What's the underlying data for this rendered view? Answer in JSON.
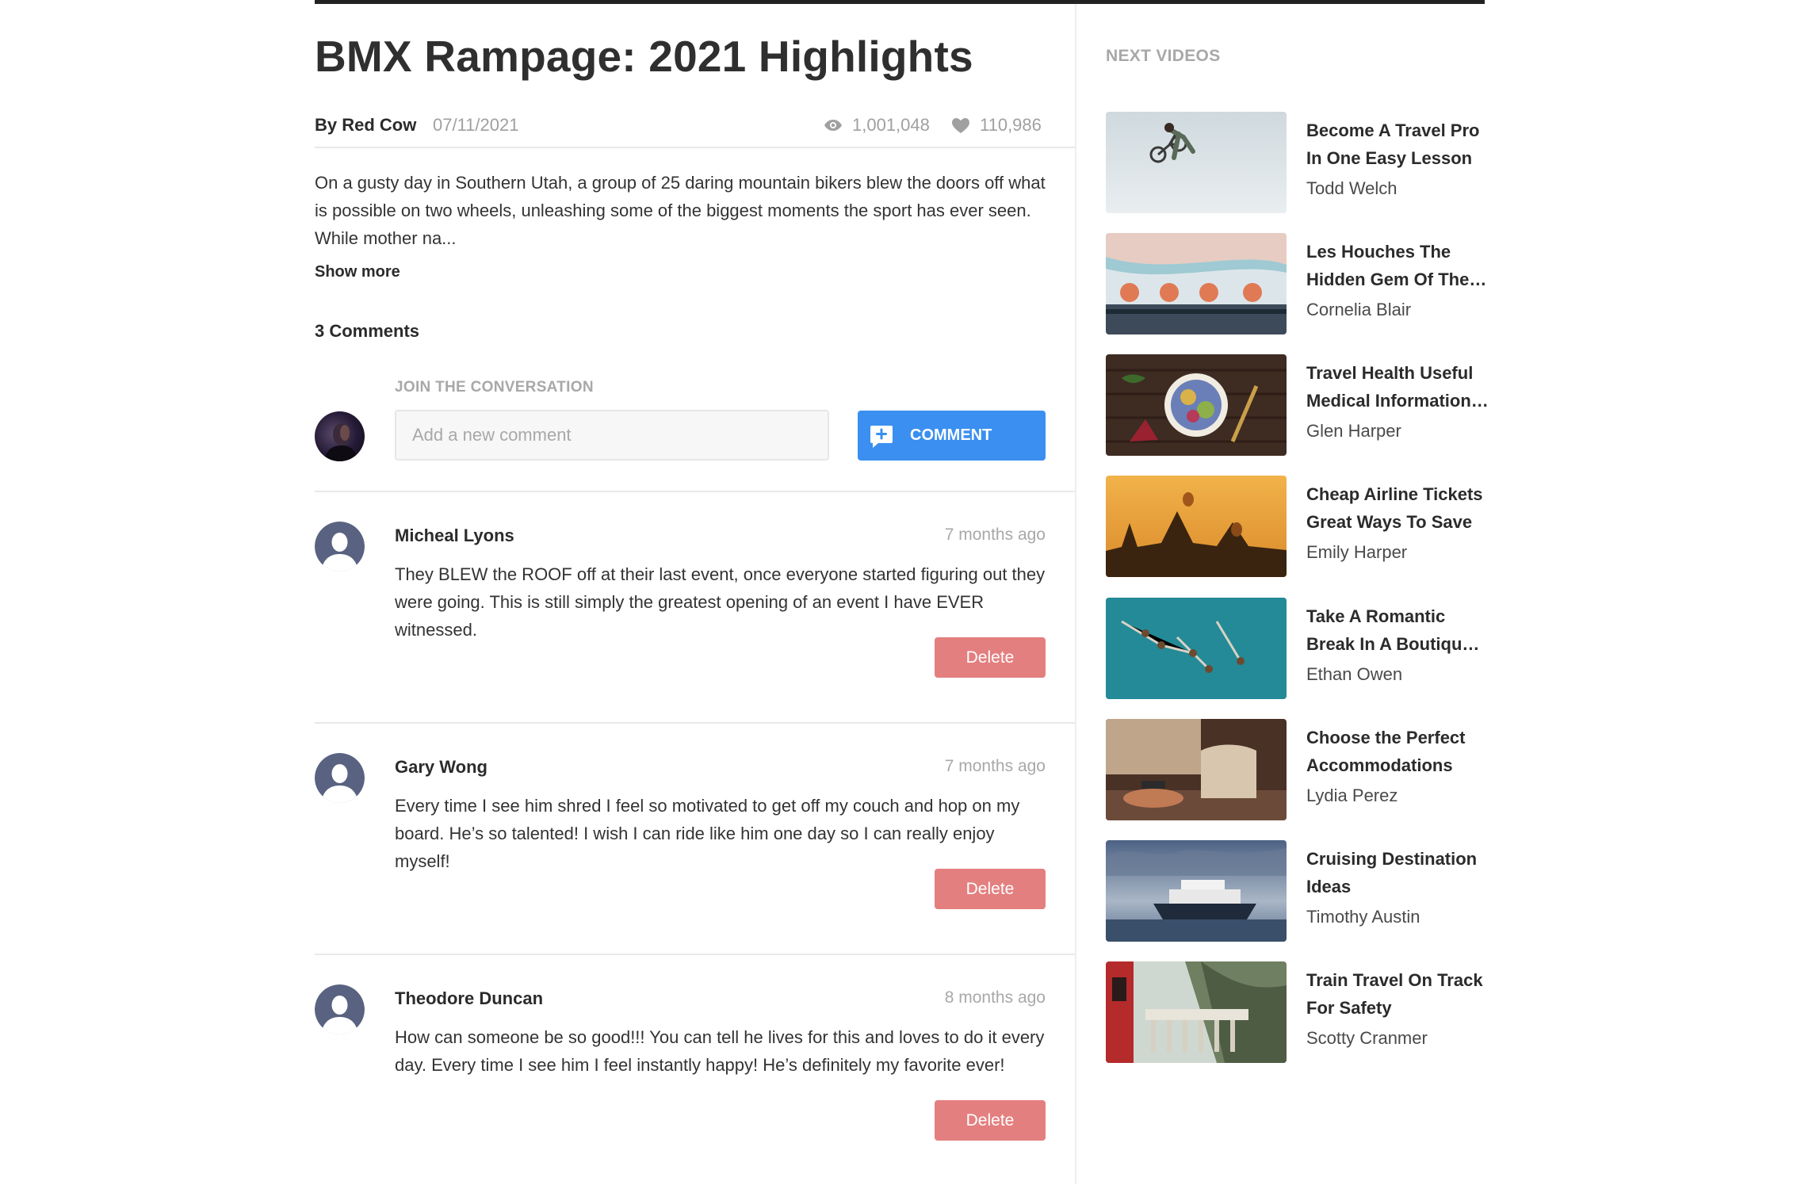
{
  "video": {
    "title": "BMX Rampage: 2021 Highlights",
    "author": "By Red Cow",
    "date": "07/11/2021",
    "views": "1,001,048",
    "likes": "110,986",
    "description": "On a gusty day in Southern Utah, a group of 25 daring mountain bikers blew the doors off what is possible on two wheels, unleashing some of the biggest moments the sport has ever seen. While mother na...",
    "show_more_label": "Show more"
  },
  "comments_section": {
    "count_label": "3 Comments",
    "join_label": "JOIN THE CONVERSATION",
    "input_placeholder": "Add a new comment",
    "input_value": "",
    "submit_label": "COMMENT",
    "delete_label": "Delete",
    "items": [
      {
        "name": "Micheal Lyons",
        "time": "7 months ago",
        "text": "They BLEW the ROOF off at their last event, once everyone started figuring out they were going. This is still simply the greatest opening of an event I have EVER witnessed."
      },
      {
        "name": "Gary Wong",
        "time": "7 months ago",
        "text": "Every time I see him shred I feel so motivated to get off my couch and hop on my board. He’s so talented! I wish I can ride like him one day so I can really enjoy myself!"
      },
      {
        "name": "Theodore Duncan",
        "time": "8 months ago",
        "text": "How can someone be so good!!! You can tell he lives for this and loves to do it every day. Every time I see him I feel instantly happy! He’s definitely my favorite ever!"
      }
    ]
  },
  "sidebar": {
    "title": "NEXT VIDEOS",
    "videos": [
      {
        "title": "Become A Travel Pro In One Easy Lesson",
        "author": "Todd Welch"
      },
      {
        "title": "Les Houches The Hidden Gem Of The Chamonix",
        "author": "Cornelia Blair"
      },
      {
        "title": "Travel Health Useful Medical Information For",
        "author": "Glen Harper"
      },
      {
        "title": "Cheap Airline Tickets Great Ways To Save",
        "author": "Emily Harper"
      },
      {
        "title": "Take A Romantic Break In A Boutique Hotel",
        "author": "Ethan Owen"
      },
      {
        "title": "Choose the Perfect Accommodations",
        "author": "Lydia Perez"
      },
      {
        "title": "Cruising Destination Ideas",
        "author": "Timothy Austin"
      },
      {
        "title": "Train Travel On Track For Safety",
        "author": "Scotty Cranmer"
      }
    ]
  },
  "colors": {
    "accent_blue": "#3a8ff0",
    "delete_red": "#e47f7f",
    "muted_text": "#a8a8a8"
  },
  "icons": {
    "views": "eye-icon",
    "likes": "heart-icon",
    "comment_button": "add-comment-icon",
    "avatar_placeholder": "user-avatar-icon"
  }
}
